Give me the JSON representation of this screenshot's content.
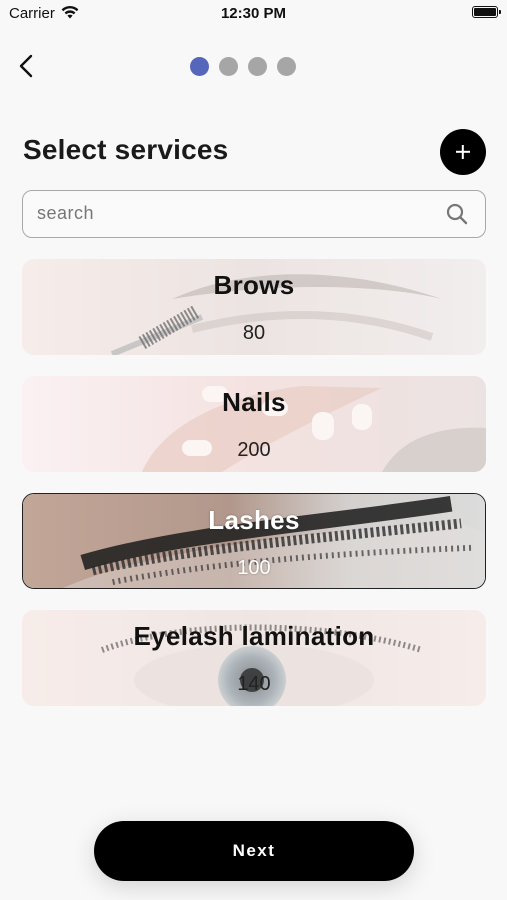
{
  "status_bar": {
    "carrier": "Carrier",
    "time": "12:30 PM"
  },
  "progress": {
    "total_steps": 4,
    "current_step": 1,
    "active_color": "#5566bb",
    "inactive_color": "#a6a6a6"
  },
  "header": {
    "title": "Select services"
  },
  "search": {
    "placeholder": "search",
    "value": ""
  },
  "services": [
    {
      "name": "Brows",
      "price": "80",
      "selected": false,
      "image": "brows-photo"
    },
    {
      "name": "Nails",
      "price": "200",
      "selected": false,
      "image": "nails-photo"
    },
    {
      "name": "Lashes",
      "price": "100",
      "selected": true,
      "image": "lashes-photo"
    },
    {
      "name": "Eyelash lamination",
      "price": "140",
      "selected": false,
      "image": "eyelash-lamination-photo"
    }
  ],
  "footer": {
    "next_label": "Next"
  },
  "icons": {
    "back": "chevron-left-icon",
    "add": "plus-icon",
    "search": "search-icon",
    "wifi": "wifi-icon",
    "battery": "battery-icon"
  }
}
